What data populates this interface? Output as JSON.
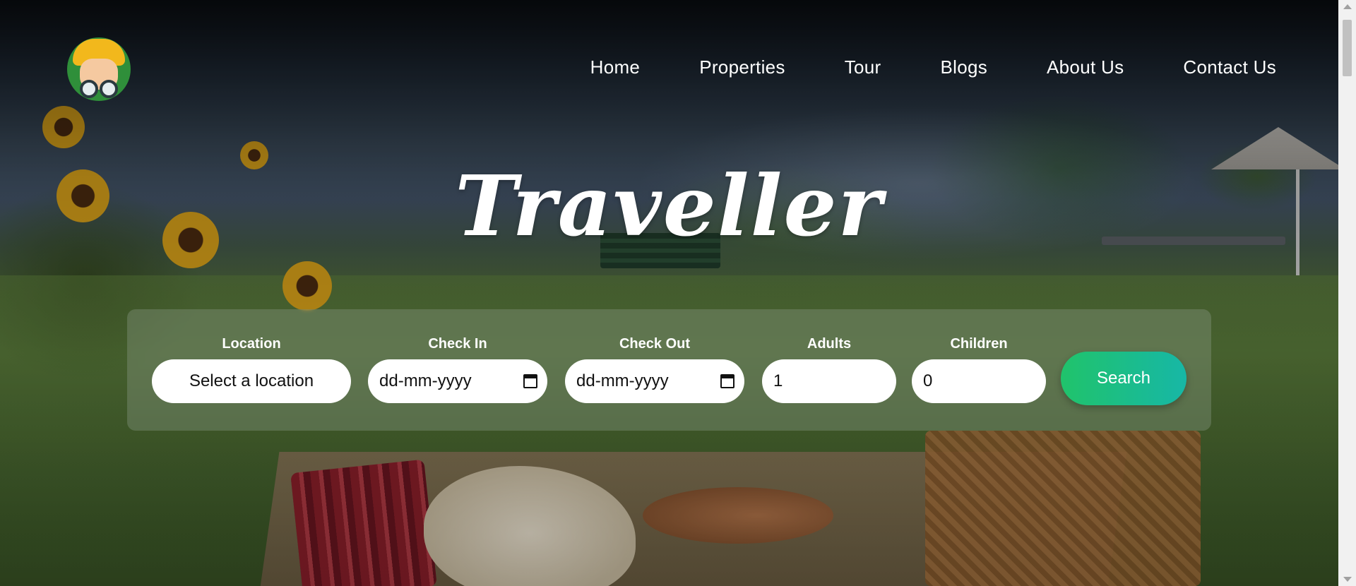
{
  "nav": {
    "items": [
      "Home",
      "Properties",
      "Tour",
      "Blogs",
      "About Us",
      "Contact Us"
    ]
  },
  "hero": {
    "title": "Traveller"
  },
  "search": {
    "location_label": "Location",
    "location_value": "Select a location",
    "checkin_label": "Check In",
    "checkin_value": "dd-mm-yyyy",
    "checkout_label": "Check Out",
    "checkout_value": "dd-mm-yyyy",
    "adults_label": "Adults",
    "adults_value": "1",
    "children_label": "Children",
    "children_value": "0",
    "button_label": "Search"
  },
  "colors": {
    "button_gradient_start": "#20c36b",
    "button_gradient_end": "#17b7a6",
    "text": "#ffffff"
  },
  "icons": {
    "logo": "traveller-mascot-logo",
    "date_picker": "calendar-icon"
  }
}
